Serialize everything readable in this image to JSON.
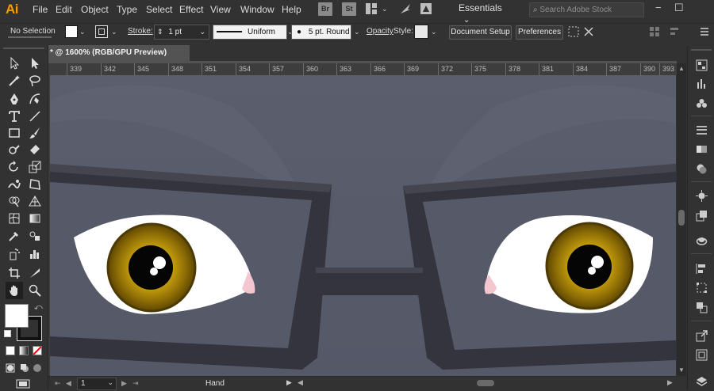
{
  "app": {
    "logo": "Ai"
  },
  "menus": [
    "File",
    "Edit",
    "Object",
    "Type",
    "Select",
    "Effect",
    "View",
    "Window",
    "Help"
  ],
  "bridge_badges": [
    "Br",
    "St"
  ],
  "workspace": {
    "label": "Essentials"
  },
  "stock_search": {
    "placeholder": "Search Adobe Stock"
  },
  "window_controls": {
    "minimize": "−",
    "maximize": "☐"
  },
  "control_bar": {
    "selection": "No Selection",
    "stroke_label": "Stroke:",
    "stroke_value": "1 pt",
    "profile": "Uniform",
    "brush": "5 pt. Round",
    "opacity_label": "Opacity",
    "style_label": "Style:",
    "document_setup": "Document Setup",
    "preferences": "Preferences"
  },
  "document_tab": {
    "title": "* @ 1600% (RGB/GPU Preview)"
  },
  "ruler": {
    "ticks": [
      "339",
      "342",
      "345",
      "348",
      "351",
      "354",
      "357",
      "360",
      "363",
      "366",
      "369",
      "372",
      "375",
      "378",
      "381",
      "384",
      "387",
      "390",
      "393"
    ]
  },
  "status_bar": {
    "artboard": "1",
    "tool": "Hand"
  },
  "colors": {
    "background": "#323232",
    "canvas": "#5a5e6c",
    "glasses_frame": "#33333f",
    "iris": "#b8950c",
    "accent_logo": "#ff9a00"
  }
}
